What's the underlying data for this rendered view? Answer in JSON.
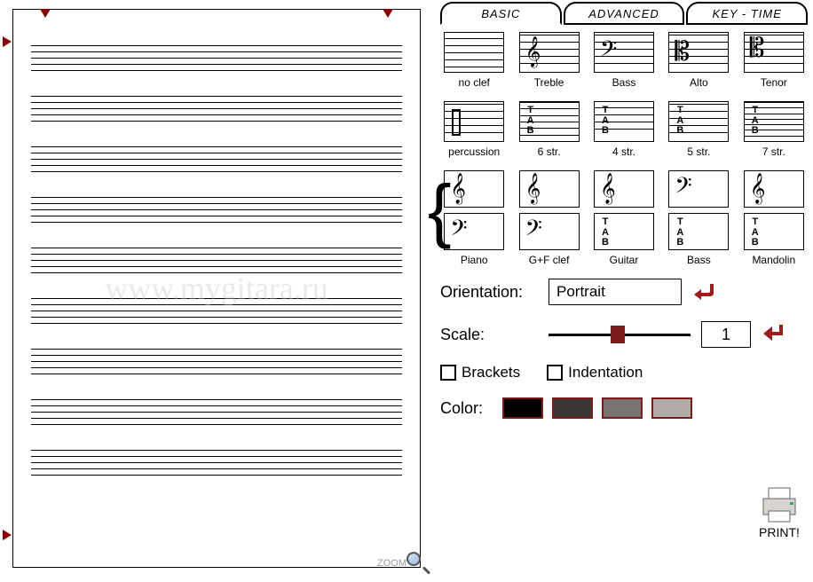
{
  "tabs": {
    "basic": "BASIC",
    "advanced": "ADVANCED",
    "keytime": "KEY - TIME"
  },
  "clefRow1": {
    "noclef": "no clef",
    "treble": "Treble",
    "bass": "Bass",
    "alto": "Alto",
    "tenor": "Tenor"
  },
  "clefRow2": {
    "percussion": "percussion",
    "str6": "6 str.",
    "str4": "4 str.",
    "str5": "5 str.",
    "str7": "7 str."
  },
  "grand": {
    "piano": "Piano",
    "gfclef": "G+F clef",
    "guitar": "Guitar",
    "bass": "Bass",
    "mandolin": "Mandolin"
  },
  "orientation": {
    "label": "Orientation:",
    "value": "Portrait"
  },
  "scale": {
    "label": "Scale:",
    "value": "1"
  },
  "brackets": "Brackets",
  "indentation": "Indentation",
  "colorLabel": "Color:",
  "colors": [
    "#000000",
    "#3a3432",
    "#7a7470",
    "#b3aca8"
  ],
  "print": "PRINT!",
  "zoom": "ZOOM",
  "watermark": "www.mygitara.ru"
}
